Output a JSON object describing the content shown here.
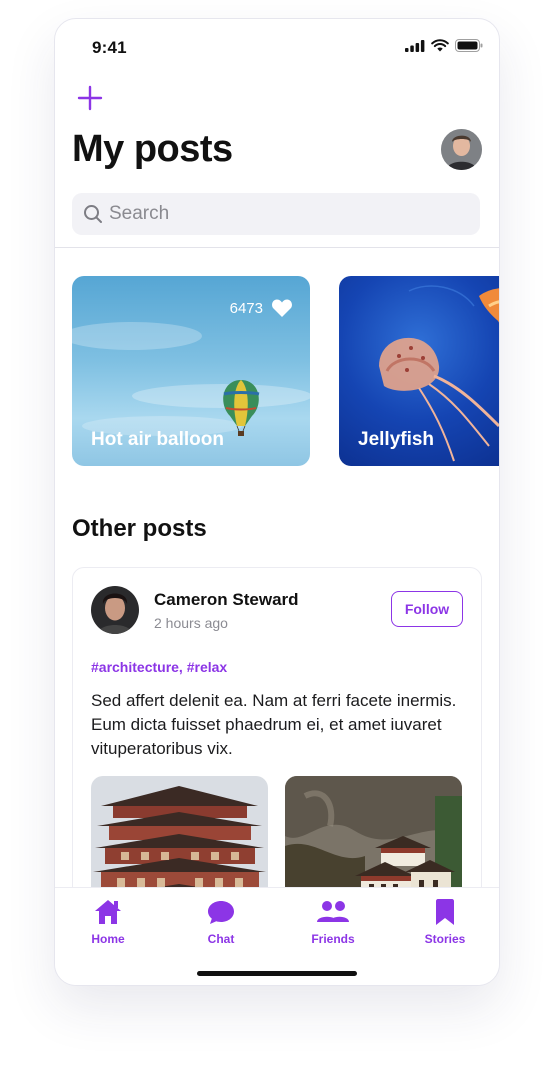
{
  "status_bar": {
    "time": "9:41"
  },
  "header": {
    "title": "My posts"
  },
  "search": {
    "placeholder": "Search"
  },
  "my_posts": [
    {
      "label": "Hot air balloon",
      "likes": "6473"
    },
    {
      "label": "Jellyfish"
    }
  ],
  "other_posts": {
    "title": "Other posts",
    "post": {
      "author": "Cameron Steward",
      "time": "2 hours ago",
      "follow_label": "Follow",
      "tags": "#architecture, #relax",
      "text": "Sed affert delenit ea. Nam at ferri facete inermis. Eum dicta fuisset phaedrum ei, et amet iuvaret vituperatoribus vix."
    }
  },
  "tab_bar": {
    "items": [
      {
        "label": "Home",
        "icon": "home-icon"
      },
      {
        "label": "Chat",
        "icon": "chat-icon"
      },
      {
        "label": "Friends",
        "icon": "friends-icon"
      },
      {
        "label": "Stories",
        "icon": "bookmark-icon"
      }
    ]
  },
  "colors": {
    "accent": "#8c35e6"
  }
}
